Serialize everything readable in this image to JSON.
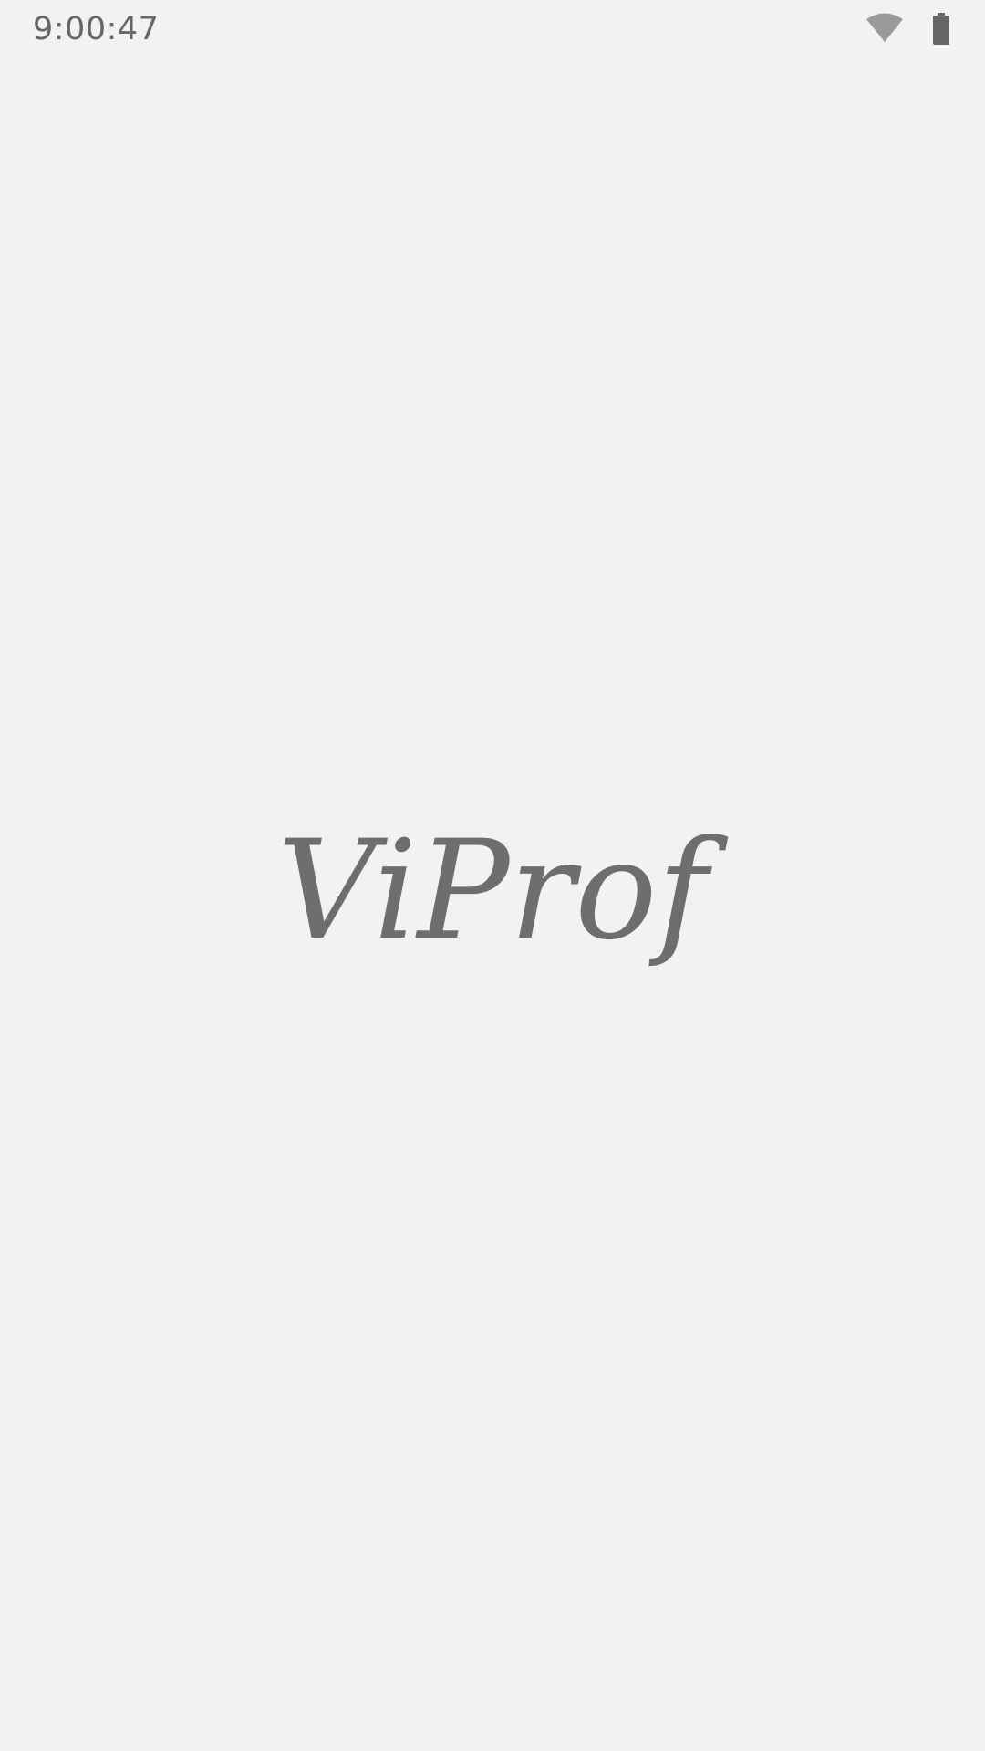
{
  "status_bar": {
    "time": "9:00:47",
    "icons": [
      "wifi-icon",
      "battery-icon"
    ],
    "icon_color": "#666666"
  },
  "splash": {
    "logo_text": "ViProf",
    "logo_color": "#6e6e6e"
  },
  "background": "#f2f2f2"
}
